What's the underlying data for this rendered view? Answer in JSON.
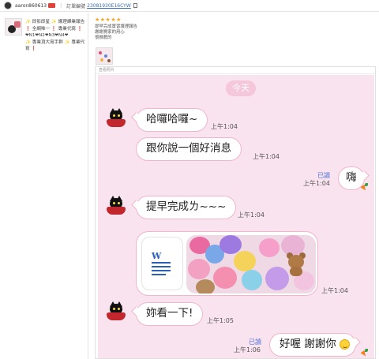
{
  "header": {
    "username": "aaron860613",
    "order_label": "訂單編號",
    "order_number": "23081930E16CYW"
  },
  "product": {
    "lines": [
      "✨ 即影即星 ✨ 護理課業報告",
      "❗ 全網唯一 ❗ 專業代寫 ❗",
      "❤N1❤N2❤N3❤N4❤",
      "✨ 專業頂大寫手群 ✨ 專業代",
      "寫 ❗"
    ]
  },
  "review": {
    "stars": "★★★★★",
    "lines": [
      "提早完成實習護理報告",
      "謝謝賣家的用心",
      "很推薦的"
    ]
  },
  "chat": {
    "header_label": "查看照片",
    "day": "今天",
    "messages": [
      {
        "text": "哈囉哈囉~",
        "time": "上午1:04"
      },
      {
        "text": "跟你說一個好消息",
        "time": "上午1:04"
      },
      {
        "text": "嗨",
        "time": "上午1:04",
        "read": "已讀"
      },
      {
        "text": "提早完成ㄌ~~~",
        "time": "上午1:04"
      },
      {
        "time": "上午1:04"
      },
      {
        "text": "妳看一下!",
        "time": "上午1:05"
      },
      {
        "text": "好喔 謝謝你",
        "time": "上午1:06",
        "read": "已讀"
      }
    ]
  },
  "colors": {
    "chat_bg": "#f8e3ee",
    "bubble_border": "#f2b5c9",
    "read_blue": "#5875d8",
    "link_blue": "#3b6fb6"
  }
}
